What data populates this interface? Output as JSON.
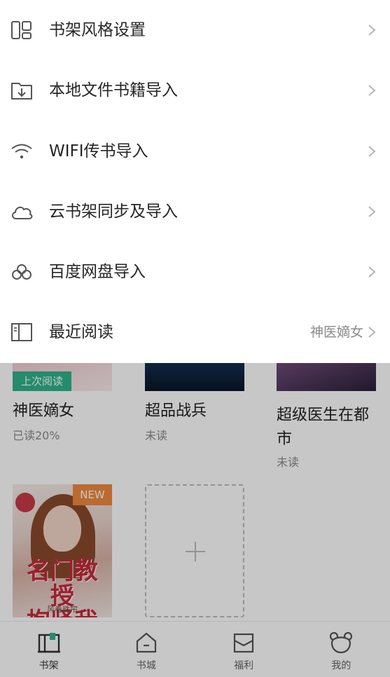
{
  "menu": {
    "items": [
      {
        "icon": "layout-icon",
        "label": "书架风格设置",
        "value": ""
      },
      {
        "icon": "import-file-icon",
        "label": "本地文件书籍导入",
        "value": ""
      },
      {
        "icon": "wifi-icon",
        "label": "WIFI传书导入",
        "value": ""
      },
      {
        "icon": "cloud-icon",
        "label": "云书架同步及导入",
        "value": ""
      },
      {
        "icon": "baidu-pan-icon",
        "label": "百度网盘导入",
        "value": ""
      },
      {
        "icon": "recent-book-icon",
        "label": "最近阅读",
        "value": "神医嫡女"
      }
    ]
  },
  "shelf": {
    "books": [
      {
        "title": "神医嫡女",
        "progress": "已读20%",
        "badge": "上次阅读"
      },
      {
        "title": "超品战兵",
        "progress": "未读",
        "badge": ""
      },
      {
        "title": "超级医生在都市",
        "progress": "未读",
        "badge": ""
      },
      {
        "title": "",
        "progress": "",
        "badge": "NEW"
      }
    ]
  },
  "tabbar": {
    "tabs": [
      {
        "label": "书架",
        "icon": "bookshelf-icon",
        "active": true
      },
      {
        "label": "书城",
        "icon": "home-icon",
        "active": false
      },
      {
        "label": "福利",
        "icon": "envelope-icon",
        "active": false
      },
      {
        "label": "我的",
        "icon": "bear-icon",
        "active": false
      }
    ]
  },
  "colors": {
    "accent": "#2fb38c",
    "new_badge": "#f08a3e",
    "text_primary": "#262626",
    "text_secondary": "#8a8a8a"
  }
}
